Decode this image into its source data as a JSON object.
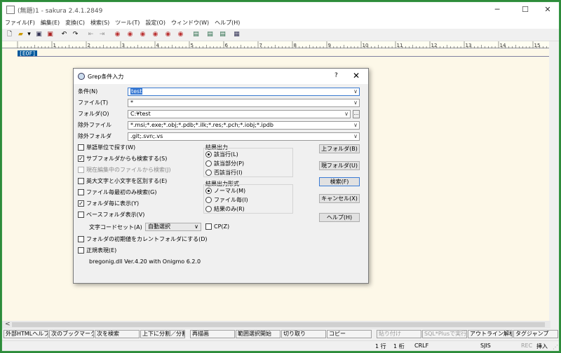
{
  "window": {
    "title": "(無題)1 - sakura 2.4.1.2849"
  },
  "menu": [
    "ファイル(F)",
    "編集(E)",
    "変換(C)",
    "検索(S)",
    "ツール(T)",
    "設定(O)",
    "ウィンドウ(W)",
    "ヘルプ(H)"
  ],
  "editor": {
    "eof": "[EOF]"
  },
  "ruler": {
    "labels": [
      "1",
      "2",
      "3",
      "4",
      "5",
      "6",
      "7",
      "8",
      "9",
      "10",
      "11",
      "12",
      "13",
      "14",
      "15"
    ]
  },
  "dialog": {
    "title": "Grep条件入力",
    "help": "?",
    "close": "✕",
    "labels": {
      "condition": "条件(N)",
      "file": "ファイル(T)",
      "folder": "フォルダ(O)",
      "exclude_file": "除外ファイル",
      "exclude_folder": "除外フォルダ"
    },
    "values": {
      "condition": "test",
      "file": "*",
      "folder": "C:¥test",
      "exclude_file": "*.msi;*.exe;*.obj;*.pdb;*.ilk;*.res;*.pch;*.iobj;*.ipdb",
      "exclude_folder": ".git;.svn;.vs"
    },
    "browse": "...",
    "checks": {
      "word": "単語単位で探す(W)",
      "subfolder": "サブフォルダからも検索する(S)",
      "current_file": "現在編集中のファイルから検索(J)",
      "case": "英大文字と小文字を区別する(E)",
      "first_only": "ファイル毎最初のみ検索(G)",
      "per_folder": "フォルダ毎に表示(Y)",
      "base_folder": "ベースフォルダ表示(V)",
      "cp": "CP(Z)",
      "init_folder": "フォルダの初期値をカレントフォルダにする(D)",
      "regex": "正規表現(E)"
    },
    "charset": {
      "label": "文字コードセット(A)",
      "value": "自動選択"
    },
    "result_output": {
      "title": "結果出力",
      "options": [
        "該当行(L)",
        "該当部分(P)",
        "否該当行(I)"
      ]
    },
    "result_format": {
      "title": "結果出力形式",
      "options": [
        "ノーマル(M)",
        "ファイル毎(I)",
        "結果のみ(R)"
      ]
    },
    "buttons": {
      "up_folder": "上フォルダ(B)",
      "cur_folder": "現フォルダ(U)",
      "search": "検索(F)",
      "cancel": "キャンセル(X)",
      "help": "ヘルプ(H)"
    },
    "version": "bregonig.dll Ver.4.20 with Onigmo 6.2.0"
  },
  "fkeys": [
    "外部HTMLヘルプ",
    "次のブックマーク",
    "次を検索",
    "上下に分割／分割",
    "再描画",
    "範囲選択開始",
    "切り取り",
    "コピー",
    "貼り付け",
    "SQL*Plusで実行",
    "アウトライン解析",
    "タグジャンプ"
  ],
  "status": {
    "line": "1 行",
    "col": "1 桁",
    "eol": "CRLF",
    "enc": "SJIS",
    "rec": "REC",
    "mode": "挿入"
  }
}
